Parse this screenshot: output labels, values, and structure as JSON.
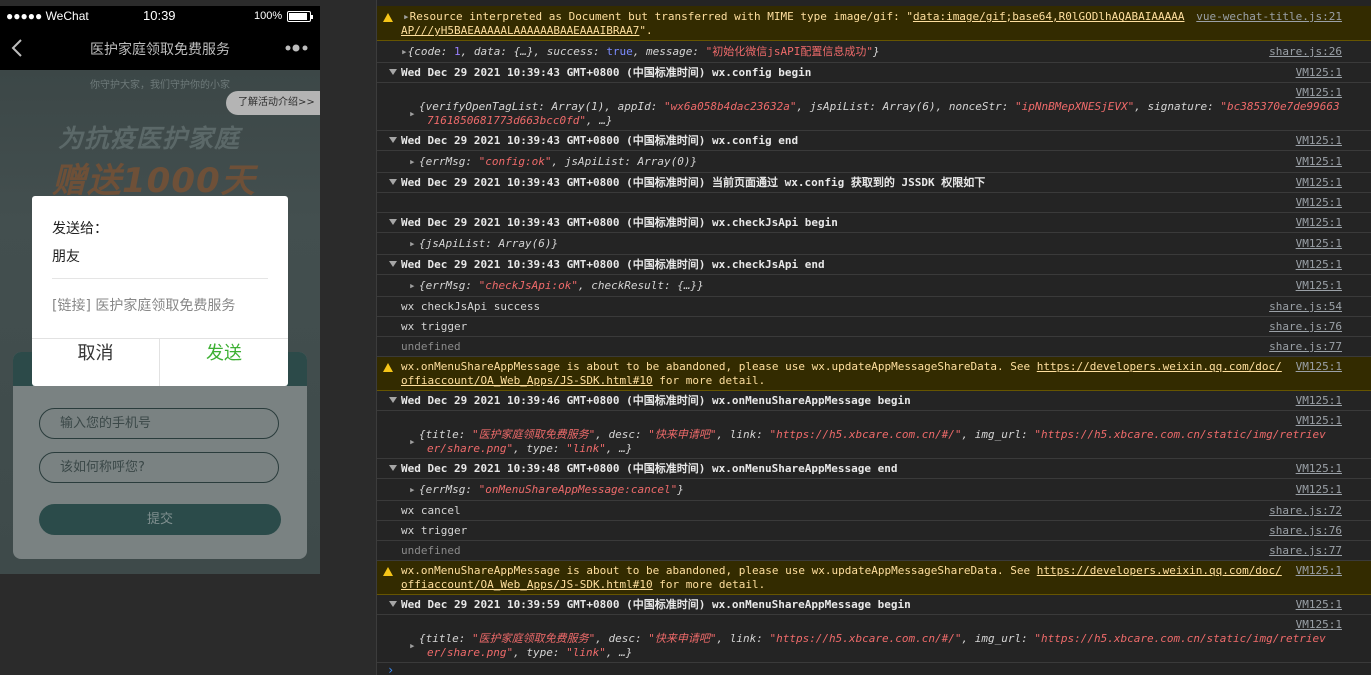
{
  "phone": {
    "status": {
      "carrier": "●●●●● WeChat",
      "time": "10:39",
      "battery": "100%"
    },
    "nav": {
      "title": "医护家庭领取免费服务"
    },
    "page": {
      "tagline": "你守护大家，我们守护你的小家",
      "promo_button": "了解活动介绍>>",
      "hero_line1": "为抗疫医护家庭",
      "hero_line2": "赠送1000天",
      "phone_placeholder": "输入您的手机号",
      "name_placeholder": "该如何称呼您?",
      "submit": "提交"
    },
    "dialog": {
      "send_to": "发送给：",
      "recipient": "朋友",
      "link_text": "[链接] 医护家庭领取免费服务",
      "cancel": "取消",
      "send": "发送"
    }
  },
  "console": {
    "r1": {
      "text1": "Resource interpreted as Document but transferred with MIME type image/gif: \"",
      "url": "data:image/gif;base64,R0lGODlhAQABAIAAAAA",
      "text2": "AP///yH5BAEAAAAALAAAAAABAAEAAAIBRAA7",
      "text3": "\".",
      "src": "vue-wechat-title.js:21"
    },
    "r2": {
      "pre": "{code: ",
      "code": "1",
      "mid1": ", data: {…}, success: ",
      "success": "true",
      "mid2": ", message: ",
      "message": "\"初始化微信jsAPI配置信息成功\"",
      "post": "}",
      "src": "share.js:26"
    },
    "r3": {
      "text": "Wed Dec 29 2021 10:39:43 GMT+0800 (中国标准时间) wx.config begin",
      "src": "VM125:1"
    },
    "r4": {
      "line1a": "{verifyOpenTagList: Array(1), appId: ",
      "appid": "\"wx6a058b4dac23632a\"",
      "line1b": ", jsApiList: Array(6), nonceStr: ",
      "nonce": "\"ipNnBMepXNESjEVX\"",
      "line1c": ", signature: ",
      "sig1": "\"bc385370e7de99663",
      "sig2": "7161850681773d663bcc0fd\"",
      "line2b": ", …}",
      "src": "VM125:1"
    },
    "r5": {
      "text": "Wed Dec 29 2021 10:39:43 GMT+0800 (中国标准时间) wx.config end",
      "src": "VM125:1"
    },
    "r6": {
      "pre": "{errMsg: ",
      "msg": "\"config:ok\"",
      "post": ", jsApiList: Array(0)}",
      "src": "VM125:1"
    },
    "r7": {
      "text": "Wed Dec 29 2021 10:39:43 GMT+0800 (中国标准时间) 当前页面通过 wx.config 获取到的 JSSDK 权限如下",
      "src": "VM125:1"
    },
    "r8": {
      "src": "VM125:1"
    },
    "r9": {
      "text": "Wed Dec 29 2021 10:39:43 GMT+0800 (中国标准时间) wx.checkJsApi begin",
      "src": "VM125:1"
    },
    "r10": {
      "text": "{jsApiList: Array(6)}",
      "src": "VM125:1"
    },
    "r11": {
      "text": "Wed Dec 29 2021 10:39:43 GMT+0800 (中国标准时间) wx.checkJsApi end",
      "src": "VM125:1"
    },
    "r12": {
      "pre": "{errMsg: ",
      "msg": "\"checkJsApi:ok\"",
      "post": ", checkResult: {…}}",
      "src": "VM125:1"
    },
    "r13": {
      "text": "wx checkJsApi success",
      "src": "share.js:54"
    },
    "r14": {
      "text": "wx trigger",
      "src": "share.js:76"
    },
    "r15": {
      "text": "undefined",
      "src": "share.js:77"
    },
    "r16": {
      "text1": "wx.onMenuShareAppMessage is about to be abandoned, please use wx.updateAppMessageShareData. See ",
      "url1": "https://developers.weixin.qq.com/doc/",
      "url2": "offiaccount/OA_Web_Apps/JS-SDK.html#10",
      "text2": " for more detail.",
      "src": "VM125:1"
    },
    "r17": {
      "text": "Wed Dec 29 2021 10:39:46 GMT+0800 (中国标准时间) wx.onMenuShareAppMessage begin",
      "src": "VM125:1"
    },
    "r18": {
      "a": "{title: ",
      "title": "\"医护家庭领取免费服务\"",
      "b": ", desc: ",
      "desc": "\"快来申请吧\"",
      "c": ", link: ",
      "link": "\"https://h5.xbcare.com.cn/#/\"",
      "d": ", img_url: ",
      "img1": "\"https://h5.xbcare.com.cn/static/img/retriev",
      "img2": "er/share.png\"",
      "e": ", type: ",
      "type": "\"link\"",
      "f": ", …}",
      "src": "VM125:1"
    },
    "r19": {
      "text": "Wed Dec 29 2021 10:39:48 GMT+0800 (中国标准时间) wx.onMenuShareAppMessage end",
      "src": "VM125:1"
    },
    "r20": {
      "pre": "{errMsg: ",
      "msg": "\"onMenuShareAppMessage:cancel\"",
      "post": "}",
      "src": "VM125:1"
    },
    "r21": {
      "text": "wx cancel",
      "src": "share.js:72"
    },
    "r22": {
      "text": "wx trigger",
      "src": "share.js:76"
    },
    "r23": {
      "text": "undefined",
      "src": "share.js:77"
    },
    "r24": {
      "text1": "wx.onMenuShareAppMessage is about to be abandoned, please use wx.updateAppMessageShareData. See ",
      "url1": "https://developers.weixin.qq.com/doc/",
      "url2": "offiaccount/OA_Web_Apps/JS-SDK.html#10",
      "text2": " for more detail.",
      "src": "VM125:1"
    },
    "r25": {
      "text": "Wed Dec 29 2021 10:39:59 GMT+0800 (中国标准时间) wx.onMenuShareAppMessage begin",
      "src": "VM125:1"
    },
    "r26": {
      "a": "{title: ",
      "title": "\"医护家庭领取免费服务\"",
      "b": ", desc: ",
      "desc": "\"快来申请吧\"",
      "c": ", link: ",
      "link": "\"https://h5.xbcare.com.cn/#/\"",
      "d": ", img_url: ",
      "img1": "\"https://h5.xbcare.com.cn/static/img/retriev",
      "img2": "er/share.png\"",
      "e": ", type: ",
      "type": "\"link\"",
      "f": ", …}",
      "src": "VM125:1"
    },
    "prompt": "›"
  }
}
